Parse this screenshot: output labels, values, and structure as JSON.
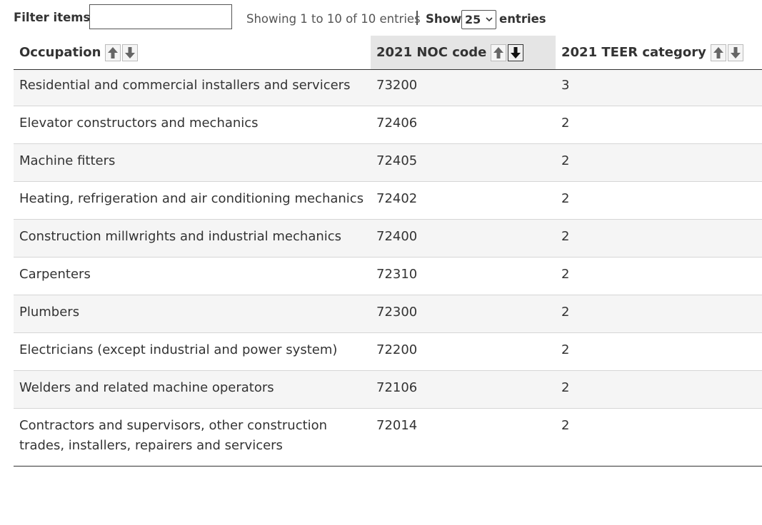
{
  "filter": {
    "label": "Filter items",
    "value": "",
    "placeholder": ""
  },
  "info": {
    "text": "Showing 1 to 10 of 10 entries"
  },
  "length_menu": {
    "show_label": "Show",
    "selected": "25",
    "entries_label": "entries"
  },
  "table": {
    "columns": [
      {
        "label": "Occupation",
        "sort": "none"
      },
      {
        "label": "2021 NOC code",
        "sort": "desc"
      },
      {
        "label": "2021 TEER category",
        "sort": "none"
      }
    ],
    "rows": [
      [
        "Residential and commercial installers and servicers",
        "73200",
        "3"
      ],
      [
        "Elevator constructors and mechanics",
        "72406",
        "2"
      ],
      [
        "Machine fitters",
        "72405",
        "2"
      ],
      [
        "Heating, refrigeration and air conditioning mechanics",
        "72402",
        "2"
      ],
      [
        "Construction millwrights and industrial mechanics",
        "72400",
        "2"
      ],
      [
        "Carpenters",
        "72310",
        "2"
      ],
      [
        "Plumbers",
        "72300",
        "2"
      ],
      [
        "Electricians (except industrial and power system)",
        "72200",
        "2"
      ],
      [
        "Welders and related machine operators",
        "72106",
        "2"
      ],
      [
        "Contractors and supervisors, other construction trades, installers, repairers and servicers",
        "72014",
        "2"
      ]
    ]
  },
  "icons": {
    "sort_up": "arrow-up-icon",
    "sort_down": "arrow-down-icon",
    "select_chevron": "chevron-down-icon"
  },
  "colors": {
    "sorted_header_bg": "#e5e5e5",
    "odd_row_bg": "#f5f5f5",
    "text": "#333333"
  }
}
